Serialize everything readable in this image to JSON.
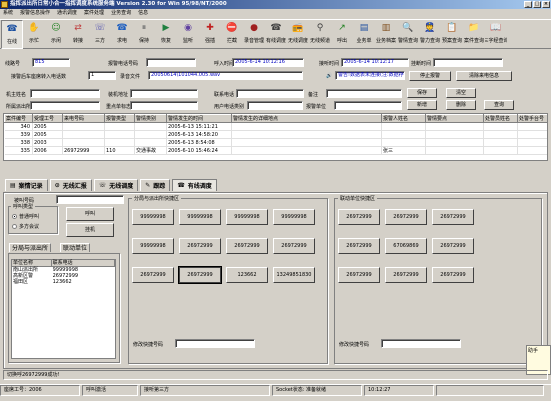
{
  "window": {
    "title": "指挥派出所日常小合一指挥调度系统服务端 Version 2.30 for Win 95/98/NT/2000",
    "min": "_",
    "max": "□",
    "close": "×"
  },
  "menu": [
    "系统",
    "报警信息操作",
    "通讯调度",
    "案件处理",
    "业务查询",
    "信息"
  ],
  "toolbar": [
    {
      "label": "在线",
      "icon": "phone-online-icon",
      "glyph": "☎",
      "color": "#1a4fa0"
    },
    {
      "label": "示忙",
      "icon": "busy-icon",
      "glyph": "✋",
      "color": "#b06020"
    },
    {
      "label": "示闲",
      "icon": "idle-icon",
      "glyph": "☺",
      "color": "#208020"
    },
    {
      "label": "转接",
      "icon": "transfer-icon",
      "glyph": "⇄",
      "color": "#c04040"
    },
    {
      "label": "三方",
      "icon": "three-way-icon",
      "glyph": "☏",
      "color": "#5050b0"
    },
    {
      "label": "求电",
      "icon": "request-call-icon",
      "glyph": "☎",
      "color": "#2060c0"
    },
    {
      "label": "保持",
      "icon": "hold-icon",
      "glyph": "⏸",
      "color": "#707070"
    },
    {
      "label": "恢复",
      "icon": "resume-icon",
      "glyph": "▶",
      "color": "#208040"
    },
    {
      "label": "监听",
      "icon": "monitor-icon",
      "glyph": "◉",
      "color": "#6040a0"
    },
    {
      "label": "强插",
      "icon": "barge-in-icon",
      "glyph": "✚",
      "color": "#c02020"
    },
    {
      "label": "拦截",
      "icon": "intercept-icon",
      "glyph": "⛔",
      "color": "#c00000"
    },
    {
      "label": "录音管理",
      "icon": "recording-icon",
      "glyph": "●",
      "color": "#a02020"
    },
    {
      "label": "有线调度",
      "icon": "wired-dispatch-icon",
      "glyph": "☎",
      "color": "#404040"
    },
    {
      "label": "无线调度",
      "icon": "wireless-dispatch-icon",
      "glyph": "📻",
      "color": "#303030"
    },
    {
      "label": "无线频道",
      "icon": "radio-channel-icon",
      "glyph": "⚲",
      "color": "#404040"
    },
    {
      "label": "呼出",
      "icon": "call-out-icon",
      "glyph": "↗",
      "color": "#208020"
    },
    {
      "label": "业务单",
      "icon": "work-order-icon",
      "glyph": "▤",
      "color": "#2050a0"
    },
    {
      "label": "业务档案",
      "icon": "archive-icon",
      "glyph": "▥",
      "color": "#805020"
    },
    {
      "label": "警情查询",
      "icon": "alarm-query-icon",
      "glyph": "🔍",
      "color": "#205080"
    },
    {
      "label": "警力查询",
      "icon": "police-query-icon",
      "glyph": "👮",
      "color": "#204080"
    },
    {
      "label": "预案查询",
      "icon": "plan-query-icon",
      "glyph": "📋",
      "color": "#406020"
    },
    {
      "label": "案件查询",
      "icon": "case-query-icon",
      "glyph": "📁",
      "color": "#a07020"
    },
    {
      "label": "三字经查询",
      "icon": "rules-query-icon",
      "glyph": "📖",
      "color": "#a02050"
    }
  ],
  "form": {
    "line_no_label": "线路号",
    "line_no": "815",
    "alarm_phone_label": "报警电话号码",
    "access_time_label": "呼入时间",
    "access_time": "2005-6-14 10:12:16",
    "answer_time_label": "接听时间",
    "answer_time": "2005-6-14 10:12:17",
    "hangup_time_label": "挂断时间",
    "route_label": "接警后车座席转入电话数",
    "route": "1",
    "recording_label": "录音文件",
    "recording": "20050614\\101044.005.wav",
    "warning_notice": "警告!数据表未连接(注:数据存储失败)",
    "stop_alarm": "停止报警",
    "clear_phone": "清除来电信息",
    "caller_name_label": "机主姓名",
    "device_addr_label": "装机地址",
    "contact_phone_label": "联系电话",
    "remark_label": "备注",
    "save": "保存",
    "clear": "清空",
    "station_label": "所属派出所",
    "tax_label": "重点单标志",
    "user_type_label": "用户电话类别",
    "reporter_label": "报警单位",
    "add": "新增",
    "delete": "删除",
    "query": "查询"
  },
  "grid": {
    "columns": [
      "案件编号",
      "受理工号",
      "来电号码",
      "报警类型",
      "警情类别",
      "警情发生的时间",
      "警情发生的详细地点",
      "报警人姓名",
      "警情要点",
      "处警员姓名",
      "处警手台号"
    ],
    "rows": [
      [
        "340",
        "2005",
        "",
        "",
        "",
        "2005-6-13 15:11:21",
        "",
        "",
        "",
        "",
        ""
      ],
      [
        "339",
        "2005",
        "",
        "",
        "",
        "2005-6-13 14:58:20",
        "",
        "",
        "",
        "",
        ""
      ],
      [
        "338",
        "2003",
        "",
        "",
        "",
        "2005-6-13 8:54:08",
        "",
        "",
        "",
        "",
        ""
      ],
      [
        "335",
        "2006",
        "26972999",
        "110",
        "交通事故",
        "2005-6-10 15:46:24",
        "",
        "张三",
        "",
        "",
        ""
      ]
    ]
  },
  "tabs": [
    {
      "label": "案情记录",
      "icon": "case-record-icon",
      "glyph": "▤"
    },
    {
      "label": "无线汇报",
      "icon": "wireless-report-icon",
      "glyph": "⊙"
    },
    {
      "label": "无线调度",
      "icon": "wireless-dispatch-tab-icon",
      "glyph": "☏"
    },
    {
      "label": "跟踪",
      "icon": "track-icon",
      "glyph": "✎"
    },
    {
      "label": "有线调度",
      "icon": "wired-dispatch-tab-icon",
      "glyph": "☎"
    }
  ],
  "dispatch": {
    "target_label": "被叫号码",
    "call_type_label": "呼叫类型",
    "radio_normal": "普通呼叫",
    "radio_multi": "多方会议",
    "call_btn": "呼叫",
    "hangup_btn": "挂机",
    "subtab_branch": "分局与派出所",
    "subtab_contact": "联动单位",
    "list_headers": [
      "单位名称",
      "联系电话"
    ],
    "list_rows": [
      [
        "南山派出所",
        "99999998"
      ],
      [
        "高新区警",
        "26972999"
      ],
      [
        "福田区",
        "123662"
      ]
    ],
    "group_branch_label": "分局与派出所快捷区",
    "branch_buttons": [
      "99999998",
      "99999998",
      "99999998",
      "99999998",
      "99999998",
      "26972999",
      "26972999",
      "26972999",
      "26972999",
      "26972999",
      "123662",
      "13249851830"
    ],
    "edit_branch_label": "修改快捷号码",
    "group_contact_label": "联动单位快捷区",
    "contact_buttons": [
      "26972999",
      "26972999",
      "26972999",
      "26972999",
      "67069869",
      "26972999",
      "26972999",
      "26972999",
      "26972999"
    ],
    "edit_contact_label": "修改快捷号码"
  },
  "message": "切换呼26972999成功!",
  "status": {
    "operator": "座席工号：2006",
    "state": "呼叫激活",
    "third": "接听第三方",
    "socket": "Socket状态: 准备就绪",
    "time": "10:12:27"
  },
  "helper": {
    "title": "助手"
  }
}
